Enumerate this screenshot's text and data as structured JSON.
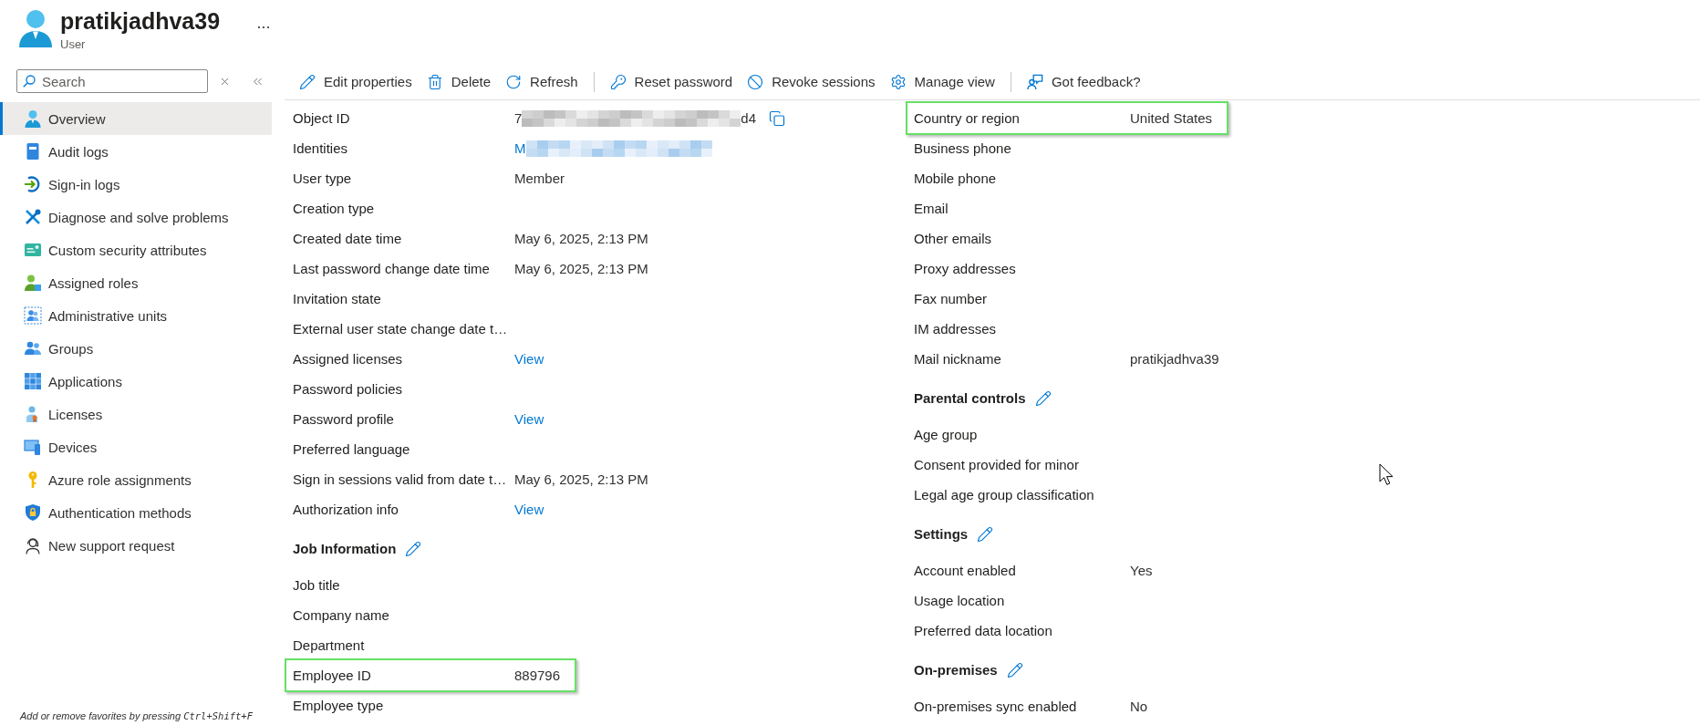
{
  "header": {
    "title": "pratikjadhva39",
    "subtitle": "User"
  },
  "sidebar": {
    "search": {
      "placeholder": "Search"
    },
    "items": [
      {
        "label": "Overview",
        "selected": true
      },
      {
        "label": "Audit logs",
        "selected": false
      },
      {
        "label": "Sign-in logs",
        "selected": false
      },
      {
        "label": "Diagnose and solve problems",
        "selected": false
      },
      {
        "label": "Custom security attributes",
        "selected": false
      },
      {
        "label": "Assigned roles",
        "selected": false
      },
      {
        "label": "Administrative units",
        "selected": false
      },
      {
        "label": "Groups",
        "selected": false
      },
      {
        "label": "Applications",
        "selected": false
      },
      {
        "label": "Licenses",
        "selected": false
      },
      {
        "label": "Devices",
        "selected": false
      },
      {
        "label": "Azure role assignments",
        "selected": false
      },
      {
        "label": "Authentication methods",
        "selected": false
      },
      {
        "label": "New support request",
        "selected": false
      }
    ],
    "hint": {
      "text": "Add or remove favorites by pressing",
      "shortcut": "Ctrl+Shift+F"
    }
  },
  "toolbar": {
    "groups": [
      [
        "Edit properties",
        "Delete",
        "Refresh"
      ],
      [
        "Reset password",
        "Revoke sessions",
        "Manage view"
      ],
      [
        "Got feedback?"
      ]
    ]
  },
  "details": {
    "left": [
      {
        "rows": [
          {
            "label": "Object ID",
            "kind": "masked",
            "value": "7",
            "value_end": "d4",
            "highlighted": false
          },
          {
            "label": "Identities",
            "kind": "masked_link",
            "value": "M",
            "highlighted": false
          },
          {
            "label": "User type",
            "kind": "text",
            "value": "Member",
            "highlighted": false
          },
          {
            "label": "Creation type",
            "kind": "empty",
            "highlighted": false
          },
          {
            "label": "Created date time",
            "kind": "text",
            "value": "May 6, 2025, 2:13 PM",
            "highlighted": false
          },
          {
            "label": "Last password change date time",
            "kind": "text",
            "value": "May 6, 2025, 2:13 PM",
            "highlighted": false
          },
          {
            "label": "Invitation state",
            "kind": "empty",
            "highlighted": false
          },
          {
            "label": "External user state change date t…",
            "kind": "empty",
            "highlighted": false
          },
          {
            "label": "Assigned licenses",
            "kind": "link",
            "value": "View",
            "highlighted": false
          },
          {
            "label": "Password policies",
            "kind": "empty",
            "highlighted": false
          },
          {
            "label": "Password profile",
            "kind": "link",
            "value": "View",
            "highlighted": false
          },
          {
            "label": "Preferred language",
            "kind": "empty",
            "highlighted": false
          },
          {
            "label": "Sign in sessions valid from date t…",
            "kind": "text",
            "value": "May 6, 2025, 2:13 PM",
            "highlighted": false
          },
          {
            "label": "Authorization info",
            "kind": "link",
            "value": "View",
            "highlighted": false
          }
        ]
      },
      {
        "heading": "Job Information",
        "rows": [
          {
            "label": "Job title",
            "kind": "empty",
            "highlighted": false
          },
          {
            "label": "Company name",
            "kind": "empty",
            "highlighted": false
          },
          {
            "label": "Department",
            "kind": "empty",
            "highlighted": false
          },
          {
            "label": "Employee ID",
            "kind": "text",
            "value": "889796",
            "highlighted": true
          },
          {
            "label": "Employee type",
            "kind": "empty",
            "highlighted": false
          }
        ]
      }
    ],
    "right": [
      {
        "rows": [
          {
            "label": "Country or region",
            "kind": "text",
            "value": "United States",
            "highlighted": true
          },
          {
            "label": "Business phone",
            "kind": "empty",
            "highlighted": false
          },
          {
            "label": "Mobile phone",
            "kind": "empty",
            "highlighted": false
          },
          {
            "label": "Email",
            "kind": "empty",
            "highlighted": false
          },
          {
            "label": "Other emails",
            "kind": "empty",
            "highlighted": false
          },
          {
            "label": "Proxy addresses",
            "kind": "empty",
            "highlighted": false
          },
          {
            "label": "Fax number",
            "kind": "empty",
            "highlighted": false
          },
          {
            "label": "IM addresses",
            "kind": "empty",
            "highlighted": false
          },
          {
            "label": "Mail nickname",
            "kind": "text",
            "value": "pratikjadhva39",
            "highlighted": false
          }
        ]
      },
      {
        "heading": "Parental controls",
        "rows": [
          {
            "label": "Age group",
            "kind": "empty",
            "highlighted": false
          },
          {
            "label": "Consent provided for minor",
            "kind": "empty",
            "highlighted": false
          },
          {
            "label": "Legal age group classification",
            "kind": "empty",
            "highlighted": false
          }
        ]
      },
      {
        "heading": "Settings",
        "rows": [
          {
            "label": "Account enabled",
            "kind": "text",
            "value": "Yes",
            "highlighted": false
          },
          {
            "label": "Usage location",
            "kind": "empty",
            "highlighted": false
          },
          {
            "label": "Preferred data location",
            "kind": "empty",
            "highlighted": false
          }
        ]
      },
      {
        "heading": "On-premises",
        "rows": [
          {
            "label": "On-premises sync enabled",
            "kind": "text",
            "value": "No",
            "highlighted": false
          }
        ]
      }
    ]
  }
}
